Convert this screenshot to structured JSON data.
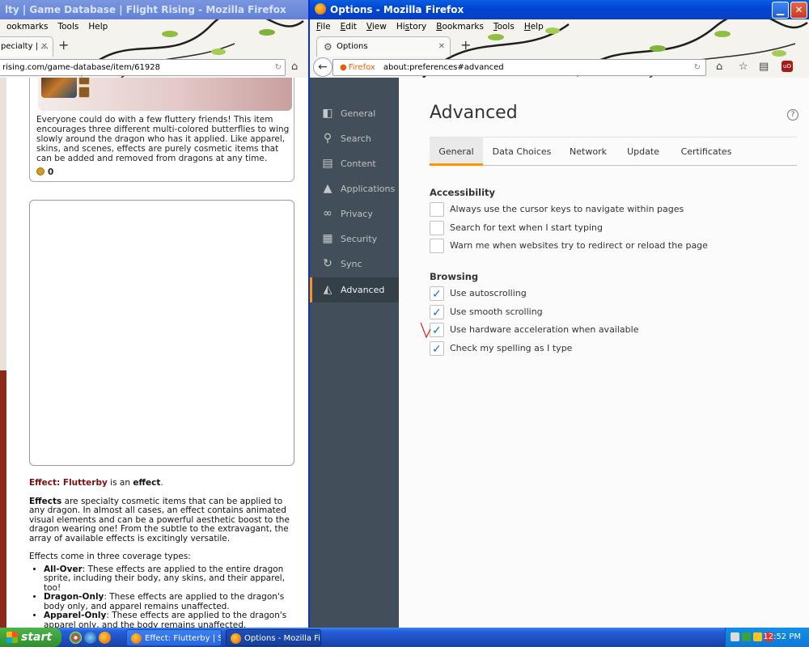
{
  "left_window": {
    "title": "lty | Game Database | Flight Rising - Mozilla Firefox",
    "menu": [
      "ookmarks",
      "Tools",
      "Help"
    ],
    "tab_label": "pecialty | ...",
    "url": "rising.com/game-database/item/61928",
    "item_description": "Everyone could do with a few fluttery friends! This item encourages three different multi-colored butterflies to wing slowly around the dragon who has it applied. Like apparel, skins, and scenes, effects are purely cosmetic items that can be added and removed from dragons at any time.",
    "price": "0",
    "effect_name": "Effect: Flutterby",
    "effect_suffix_1": " is an ",
    "effect_word": "effect",
    "effect_suffix_2": ".",
    "effects_bold": "Effects",
    "effects_para": " are specialty cosmetic items that can be applied to any dragon. In almost all cases, an effect contains animated visual elements and can be a powerful aesthetic boost to the dragon wearing one! From the subtle to the extravagant, the array of available effects is excitingly versatile.",
    "coverage_intro": "Effects come in three coverage types:",
    "coverage": [
      {
        "name": "All-Over",
        "text": ": These effects are applied to the entire dragon sprite, including their body, any skins, and their apparel, too!"
      },
      {
        "name": "Dragon-Only",
        "text": ": These effects are applied to the dragon's body only, and apparel remains unaffected."
      },
      {
        "name": "Apparel-Only",
        "text": ": These effects are applied to the dragon's apparel only, and the body remains unaffected."
      }
    ]
  },
  "right_window": {
    "title": "Options - Mozilla Firefox",
    "menu": [
      {
        "label": "File",
        "u": "F"
      },
      {
        "label": "Edit",
        "u": "E"
      },
      {
        "label": "View",
        "u": "V"
      },
      {
        "label": "History",
        "u": "s"
      },
      {
        "label": "Bookmarks",
        "u": "B"
      },
      {
        "label": "Tools",
        "u": "T"
      },
      {
        "label": "Help",
        "u": "H"
      }
    ],
    "tab_label": "Options",
    "identity_label": "Firefox",
    "url": "about:preferences#advanced",
    "categories": [
      {
        "label": "General",
        "icon": "switch-icon",
        "glyph": "◧"
      },
      {
        "label": "Search",
        "icon": "search-icon",
        "glyph": "⚲"
      },
      {
        "label": "Content",
        "icon": "document-icon",
        "glyph": "▤"
      },
      {
        "label": "Applications",
        "icon": "rocket-icon",
        "glyph": "▲"
      },
      {
        "label": "Privacy",
        "icon": "mask-icon",
        "glyph": "∞"
      },
      {
        "label": "Security",
        "icon": "lock-icon",
        "glyph": "▦"
      },
      {
        "label": "Sync",
        "icon": "sync-icon",
        "glyph": "↻"
      },
      {
        "label": "Advanced",
        "icon": "wizard-hat-icon",
        "glyph": "◭"
      }
    ],
    "selected_category": "Advanced",
    "heading": "Advanced",
    "tabs": [
      "General",
      "Data Choices",
      "Network",
      "Update",
      "Certificates"
    ],
    "selected_tab": "General",
    "accessibility": {
      "title": "Accessibility",
      "options": [
        {
          "label": "Always use the cursor keys to navigate within pages",
          "checked": false
        },
        {
          "label": "Search for text when I start typing",
          "checked": false
        },
        {
          "label": "Warn me when websites try to redirect or reload the page",
          "checked": false
        }
      ]
    },
    "browsing": {
      "title": "Browsing",
      "options": [
        {
          "label": "Use autoscrolling",
          "checked": true
        },
        {
          "label": "Use smooth scrolling",
          "checked": true
        },
        {
          "label": "Use hardware acceleration when available",
          "checked": true
        },
        {
          "label": "Check my spelling as I type",
          "checked": true
        }
      ]
    }
  },
  "taskbar": {
    "start_label": "start",
    "buttons": [
      "Effect: Flutterby | Sp...",
      "Options - Mozilla Firefox"
    ],
    "clock": "12:52 PM"
  },
  "colors": {
    "accent": "#ff9500",
    "sidebar": "#424f5a",
    "xp_blue": "#245edb",
    "effect_name": "#7a1010"
  }
}
